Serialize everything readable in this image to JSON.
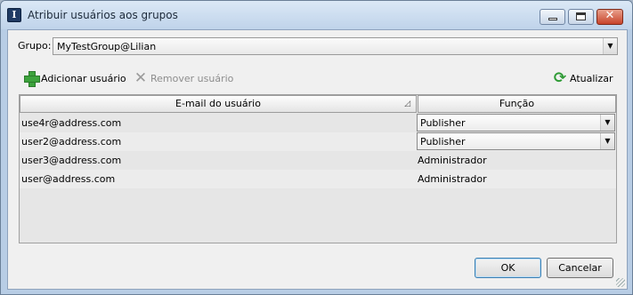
{
  "window": {
    "title": "Atribuir usuários aos grupos",
    "icon": "app-logo-icon"
  },
  "group": {
    "label": "Grupo:",
    "selected": "MyTestGroup@Lilian"
  },
  "toolbar": {
    "add_label": "Adicionar usuário",
    "remove_label": "Remover usuário",
    "refresh_label": "Atualizar"
  },
  "table": {
    "headers": [
      "E-mail do usuário",
      "Função"
    ],
    "rows": [
      {
        "email": "use4r@address.com",
        "role": "Publisher",
        "editable": true
      },
      {
        "email": "user2@address.com",
        "role": "Publisher",
        "editable": true
      },
      {
        "email": "user3@address.com",
        "role": "Administrador",
        "editable": false
      },
      {
        "email": "user@address.com",
        "role": "Administrador",
        "editable": false
      }
    ]
  },
  "buttons": {
    "ok": "OK",
    "cancel": "Cancelar"
  }
}
